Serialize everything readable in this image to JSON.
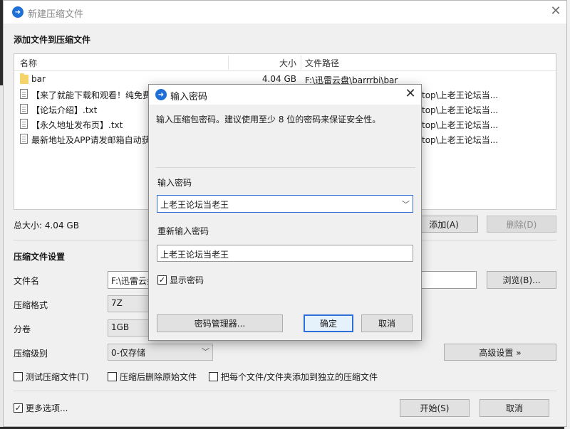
{
  "main_window": {
    "title": "新建压缩文件",
    "close_glyph": "✕",
    "add_files_heading": "添加文件到压缩文件",
    "file_list": {
      "headers": {
        "name": "名称",
        "size": "大小",
        "path": "文件路径"
      },
      "rows": [
        {
          "type": "folder",
          "name": "bar",
          "size": "4.04 GB",
          "path": "F:\\迅雷云盘\\barrrbi\\bar"
        },
        {
          "type": "file",
          "name": "【来了就能下载和观看！纯免费",
          "size": "",
          "path": "top\\上老王论坛当..."
        },
        {
          "type": "file",
          "name": "【论坛介绍】.txt",
          "size": "",
          "path": "top\\上老王论坛当..."
        },
        {
          "type": "file",
          "name": "【永久地址发布页】.txt",
          "size": "",
          "path": "top\\上老王论坛当..."
        },
        {
          "type": "file",
          "name": "最新地址及APP请发邮箱自动获",
          "size": "",
          "path": "top\\上老王论坛当..."
        }
      ]
    },
    "total_size": "总大小: 4.04 GB",
    "add_button": "添加(A)",
    "delete_button": "删除(D)",
    "settings_heading": "压缩文件设置",
    "filename_label": "文件名",
    "filename_value": "F:\\迅雷云盘",
    "browse_button": "浏览(B)...",
    "format_label": "压缩格式",
    "format_value": "7Z",
    "volume_label": "分卷",
    "volume_value": "1GB",
    "level_label": "压缩级别",
    "level_value": "0-仅存储",
    "advanced_button": "高级设置 »",
    "test_checkbox": "测试压缩文件(T)",
    "delete_original_checkbox": "压缩后删除原始文件",
    "separate_checkbox": "把每个文件/文件夹添加到独立的压缩文件",
    "more_options_checkbox": "更多选项...",
    "start_button": "开始(S)",
    "cancel_button": "取消"
  },
  "password_dialog": {
    "title": "输入密码",
    "close_glyph": "✕",
    "description": "输入压缩包密码。建议使用至少 8 位的密码来保证安全性。",
    "password_label": "输入密码",
    "password_value": "上老王论坛当老王",
    "reenter_label": "重新输入密码",
    "reenter_value": "上老王论坛当老王",
    "show_password_label": "显示密码",
    "show_password_checked": true,
    "manager_button": "密码管理器...",
    "ok_button": "确定",
    "cancel_button": "取消"
  },
  "colors": {
    "accent": "#2d6ed8",
    "app_icon": "#1e6fd6",
    "folder": "#f6d26a"
  },
  "icons": {
    "app": "app-logo-icon",
    "folder": "folder-icon",
    "file": "text-file-icon",
    "dropdown": "chevron-down-icon",
    "close": "close-icon",
    "check": "checkmark-icon"
  }
}
